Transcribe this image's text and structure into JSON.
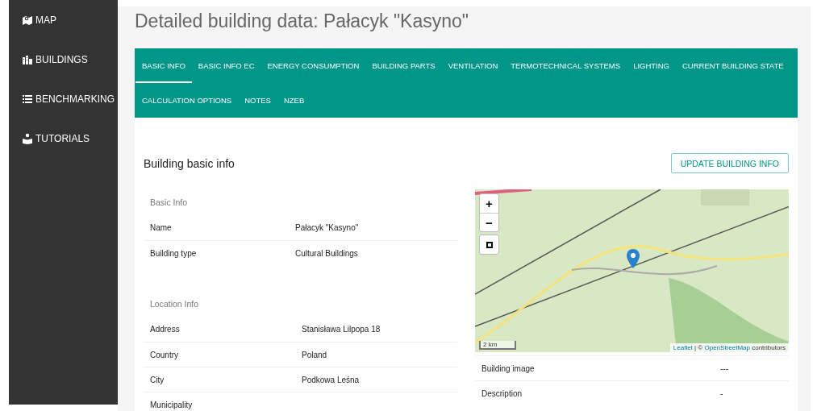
{
  "sidebar": {
    "items": [
      {
        "kind": "map",
        "label": "MAP"
      },
      {
        "kind": "buildings",
        "label": "BUILDINGS"
      },
      {
        "kind": "list",
        "label": "BENCHMARKING"
      },
      {
        "kind": "tutorials",
        "label": "TUTORIALS"
      }
    ]
  },
  "title": "Detailed building data: Pałacyk \"Kasyno\"",
  "tabs": [
    {
      "label": "BASIC INFO",
      "selected": true
    },
    {
      "label": "BASIC INFO EC",
      "selected": false
    },
    {
      "label": "ENERGY CONSUMPTION",
      "selected": false
    },
    {
      "label": "BUILDING PARTS",
      "selected": false
    },
    {
      "label": "VENTILATION",
      "selected": false
    },
    {
      "label": "TERMOTECHNICAL SYSTEMS",
      "selected": false
    },
    {
      "label": "LIGHTING",
      "selected": false
    },
    {
      "label": "CURRENT BUILDING STATE",
      "selected": false
    },
    {
      "label": "CALCULATION OPTIONS",
      "selected": false
    },
    {
      "label": "NOTES",
      "selected": false
    },
    {
      "label": "NZEB",
      "selected": false
    }
  ],
  "card": {
    "title": "Building basic info",
    "button": "UPDATE BUILDING INFO"
  },
  "basic_info": {
    "heading": "Basic Info",
    "rows": [
      {
        "label": "Name",
        "value": "Pałacyk \"Kasyno\""
      },
      {
        "label": "Building type",
        "value": "Cultural Buildings"
      }
    ]
  },
  "location_info": {
    "heading": "Location Info",
    "rows": [
      {
        "label": "Address",
        "value": "Stanisława Lilpopa 18"
      },
      {
        "label": "Country",
        "value": "Poland"
      },
      {
        "label": "City",
        "value": "Podkowa Leśna"
      },
      {
        "label": "Municipality"
      }
    ]
  },
  "map": {
    "zoom_in": "+",
    "zoom_out": "−",
    "scale": "2 km",
    "attribution": [
      {
        "text": "Leaflet",
        "link": true
      },
      {
        "text": " | © ",
        "link": false
      },
      {
        "text": "OpenStreetMap",
        "link": true
      },
      {
        "text": " contributors",
        "link": false
      }
    ]
  },
  "extra_rows": [
    {
      "label": "Building image",
      "value": "---"
    },
    {
      "label": "Description",
      "value": "-"
    }
  ]
}
